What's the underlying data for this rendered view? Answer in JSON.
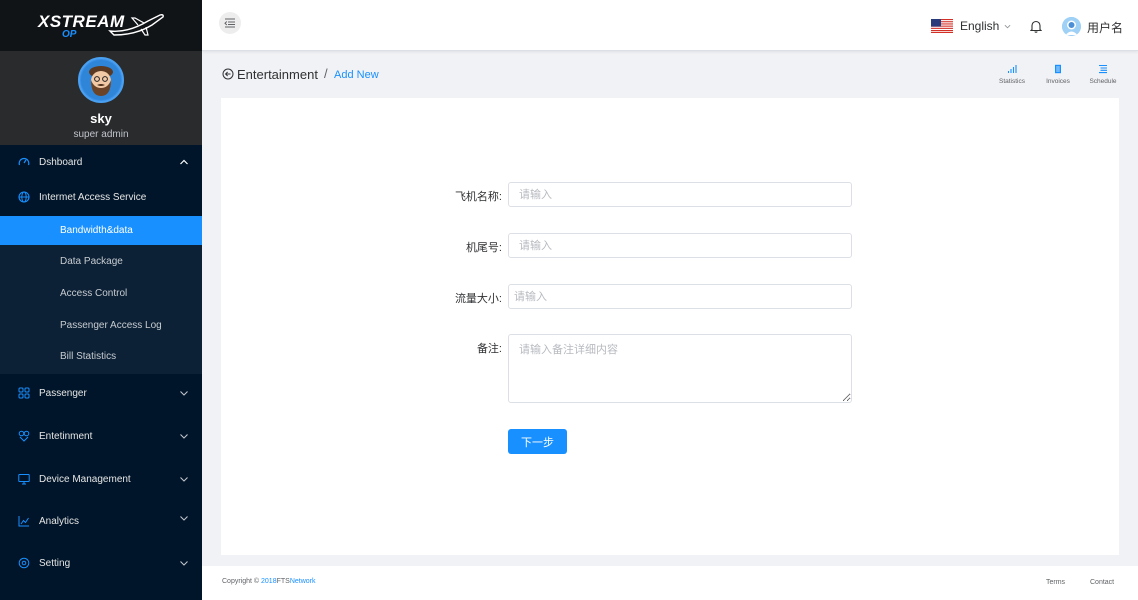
{
  "brand": {
    "logo_main": "XSTREAM",
    "logo_sub": "OP"
  },
  "profile": {
    "name": "sky",
    "role": "super admin"
  },
  "sidebar": {
    "items": [
      {
        "label": "Dshboard",
        "icon": "speedometer-icon"
      },
      {
        "label": "Intermet Access Service",
        "icon": "globe-icon"
      },
      {
        "label": "Passenger",
        "icon": "people-icon"
      },
      {
        "label": "Entetinment",
        "icon": "entertainment-icon"
      },
      {
        "label": "Device Management",
        "icon": "monitor-icon"
      },
      {
        "label": "Analytics",
        "icon": "chart-icon"
      },
      {
        "label": "Setting",
        "icon": "gear-icon"
      }
    ],
    "subitems": [
      {
        "label": "Bandwidth&data",
        "active": true
      },
      {
        "label": "Data Package"
      },
      {
        "label": "Access Control"
      },
      {
        "label": "Passenger Access Log"
      },
      {
        "label": "Bill Statistics"
      }
    ]
  },
  "header": {
    "language": "English",
    "user_name": "用户名"
  },
  "page": {
    "title": "Entertainment",
    "separator": "/",
    "subtitle": "Add New",
    "quick_links": [
      {
        "label": "Statistics",
        "icon": "bar-chart-icon"
      },
      {
        "label": "Invoices",
        "icon": "document-icon"
      },
      {
        "label": "Schedule",
        "icon": "list-icon"
      }
    ]
  },
  "form": {
    "aircraft_name": {
      "label": "飞机名称:",
      "placeholder": "请输入",
      "value": ""
    },
    "tail_number": {
      "label": "机尾号:",
      "placeholder": "请输入",
      "value": ""
    },
    "traffic_size": {
      "label": "流量大小:",
      "placeholder": "请输入",
      "value": ""
    },
    "remarks": {
      "label": "备注:",
      "placeholder": "请输入备注详细内容",
      "value": ""
    },
    "next_label": "下一步"
  },
  "footer": {
    "copyright_prefix": "Copyright ©",
    "copyright_year": "2018",
    "copyright_company": "FTS",
    "copyright_suffix": "Network",
    "links": [
      "Terms",
      "Contact"
    ]
  },
  "colors": {
    "accent": "#1890ff",
    "sidebar_bg": "#001529",
    "logo_bar_bg": "#111417",
    "profile_bg": "#2a2b2d"
  }
}
